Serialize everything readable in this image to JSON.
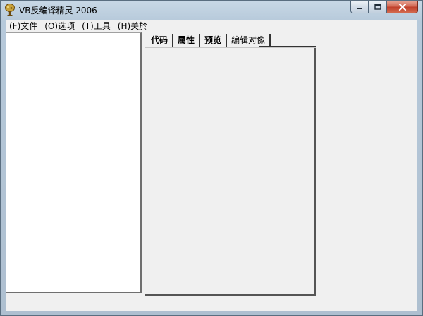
{
  "window": {
    "title": "VB反编译精灵 2006"
  },
  "menubar": {
    "items": [
      {
        "label": "(F)文件"
      },
      {
        "label": "(O)选项"
      },
      {
        "label": "(T)工具"
      },
      {
        "label": "(H)关於"
      }
    ]
  },
  "tabs": {
    "items": [
      {
        "label": "代码"
      },
      {
        "label": "属性"
      },
      {
        "label": "预览"
      },
      {
        "label": "编辑对像"
      }
    ]
  },
  "colors": {
    "title_gradient_top": "#c8d8e6",
    "menu_background": "#f0f0f0",
    "close_button": "#c0402b"
  },
  "icons": {
    "app": "app-tree-icon",
    "minimize": "minimize-icon",
    "maximize": "maximize-icon",
    "close": "close-icon"
  }
}
